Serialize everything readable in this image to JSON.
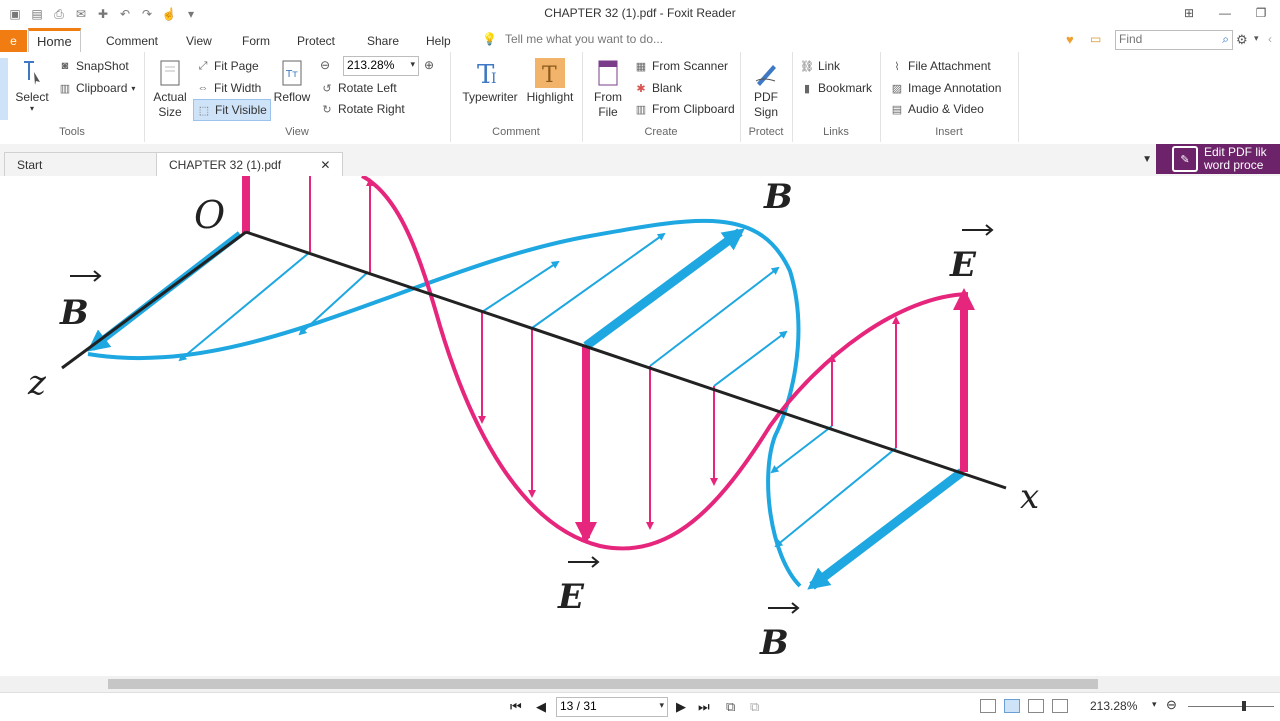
{
  "window": {
    "title": "CHAPTER 32 (1).pdf - Foxit Reader"
  },
  "menu": {
    "file": "e",
    "tabs": [
      "Home",
      "Comment",
      "View",
      "Form",
      "Protect",
      "Share",
      "Help"
    ],
    "tell_me": "Tell me what you want to do...",
    "find_placeholder": "Find"
  },
  "ribbon": {
    "tools": {
      "label": "Tools",
      "select": "Select",
      "snapshot": "SnapShot",
      "clipboard": "Clipboard"
    },
    "view": {
      "label": "View",
      "actual_size": "Actual Size",
      "fit_page": "Fit Page",
      "fit_width": "Fit Width",
      "fit_visible": "Fit Visible",
      "reflow": "Reflow",
      "zoom_value": "213.28%",
      "rotate_left": "Rotate Left",
      "rotate_right": "Rotate Right"
    },
    "comment": {
      "label": "Comment",
      "typewriter": "Typewriter",
      "highlight": "Highlight"
    },
    "create": {
      "label": "Create",
      "from_file": "From File",
      "from_scanner": "From Scanner",
      "blank": "Blank",
      "from_clipboard": "From Clipboard"
    },
    "protect": {
      "label": "Protect",
      "pdf_sign": "PDF Sign"
    },
    "links": {
      "label": "Links",
      "link": "Link",
      "bookmark": "Bookmark"
    },
    "insert": {
      "label": "Insert",
      "file_attachment": "File Attachment",
      "image_annotation": "Image Annotation",
      "audio_video": "Audio & Video"
    }
  },
  "doc_tabs": {
    "start": "Start",
    "file": "CHAPTER 32 (1).pdf",
    "banner_line1": "Edit PDF lik",
    "banner_line2": "word proce"
  },
  "figure": {
    "label_o": "O",
    "label_b": "B",
    "label_e": "E",
    "label_z": "z",
    "label_x": "x",
    "e_color": "#e6267c",
    "b_color": "#1ea7e0"
  },
  "status": {
    "page": "13 / 31",
    "zoom": "213.28%"
  }
}
